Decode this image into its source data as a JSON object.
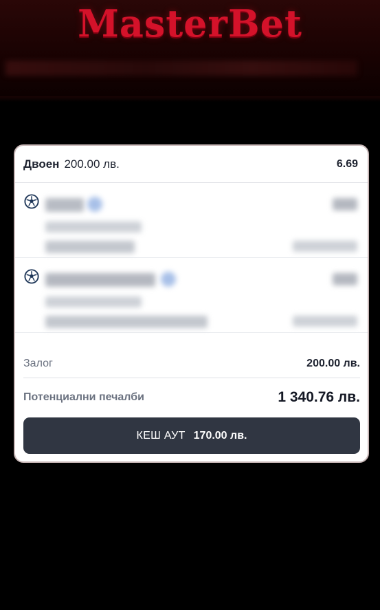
{
  "brand": {
    "logo_text": "MasterBet",
    "color": "#d4122a"
  },
  "bet_slip": {
    "bet_type": "Двоен",
    "bet_amount": "200.00 лв.",
    "total_odds": "6.69",
    "selections": [
      {
        "sport_icon": "soccer-ball-icon",
        "content": "blurred"
      },
      {
        "sport_icon": "soccer-ball-icon",
        "content": "blurred"
      }
    ],
    "stake_label": "Залог",
    "stake_value": "200.00 лв.",
    "potential_win_label": "Потенциални печалби",
    "potential_win_value": "1 340.76 лв.",
    "cashout_label": "КЕШ АУТ",
    "cashout_amount": "170.00 лв.",
    "cashout_button_color": "#303642"
  }
}
